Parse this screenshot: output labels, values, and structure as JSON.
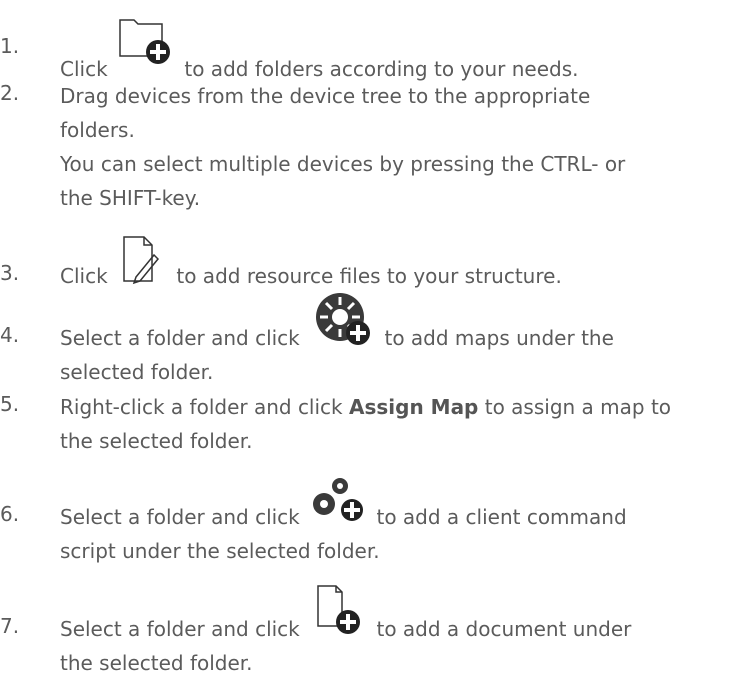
{
  "steps": [
    {
      "number": "1.",
      "before": "Click",
      "icon": "add-folder-icon",
      "after": "to add folders according to your needs."
    },
    {
      "number": "2.",
      "lines": [
        "Drag devices from the device tree to the appropriate",
        "folders."
      ]
    },
    {
      "note_lines": [
        "You can select multiple devices by pressing the CTRL- or",
        "the SHIFT-key."
      ]
    },
    {
      "number": "3.",
      "before": "Click",
      "icon": "add-resource-file-icon",
      "after": "to add resource files to your structure."
    },
    {
      "number": "4.",
      "before": "Select a folder and click",
      "icon": "add-map-icon",
      "after": "to add maps under the",
      "line2": "selected folder."
    },
    {
      "number": "5.",
      "before": "Right-click a folder and click",
      "bold": "Assign Map",
      "after": "to assign a map to",
      "line2": "the selected folder."
    },
    {
      "number": "6.",
      "before": "Select a folder and click",
      "icon": "add-script-icon",
      "after": "to add a client command",
      "line2": "script under the selected folder."
    },
    {
      "number": "7.",
      "before": "Select a folder and click",
      "icon": "add-document-icon",
      "after": "to add a document under",
      "line2": "the selected folder."
    }
  ]
}
